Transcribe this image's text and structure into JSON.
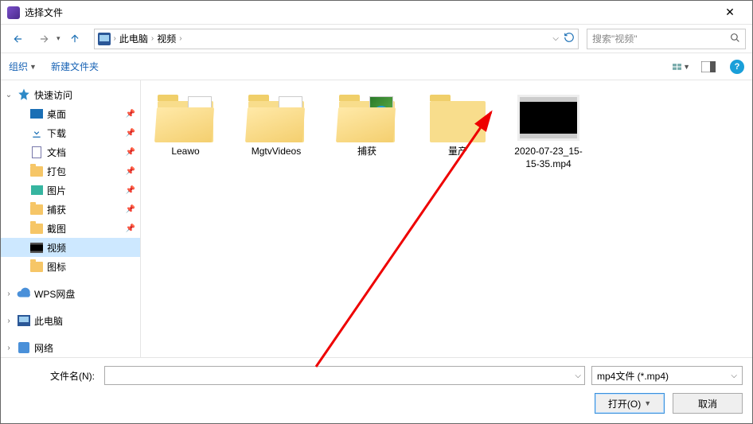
{
  "window": {
    "title": "选择文件"
  },
  "address": {
    "crumbs": [
      "此电脑",
      "视频"
    ],
    "search_placeholder": "搜索\"视频\""
  },
  "toolbar": {
    "organize": "组织",
    "new_folder": "新建文件夹"
  },
  "sidebar": {
    "quick_access": "快速访问",
    "items_pinned": [
      {
        "label": "桌面",
        "icon": "desktop"
      },
      {
        "label": "下载",
        "icon": "download"
      },
      {
        "label": "文档",
        "icon": "docs"
      },
      {
        "label": "打包",
        "icon": "folder"
      },
      {
        "label": "图片",
        "icon": "pic"
      },
      {
        "label": "捕获",
        "icon": "folder"
      },
      {
        "label": "截图",
        "icon": "folder"
      }
    ],
    "items_plain": [
      {
        "label": "视频",
        "icon": "video",
        "selected": true
      },
      {
        "label": "图标",
        "icon": "folder"
      }
    ],
    "wps": "WPS网盘",
    "this_pc": "此电脑",
    "network": "网络"
  },
  "files": [
    {
      "name": "Leawo",
      "type": "folder-peek"
    },
    {
      "name": "MgtvVideos",
      "type": "folder-peek"
    },
    {
      "name": "捕获",
      "type": "folder-peek-green"
    },
    {
      "name": "量产",
      "type": "folder"
    },
    {
      "name": "2020-07-23_15-15-35.mp4",
      "type": "video"
    }
  ],
  "bottom": {
    "filename_label": "文件名(N):",
    "filetype": "mp4文件 (*.mp4)",
    "open": "打开(O)",
    "cancel": "取消"
  }
}
